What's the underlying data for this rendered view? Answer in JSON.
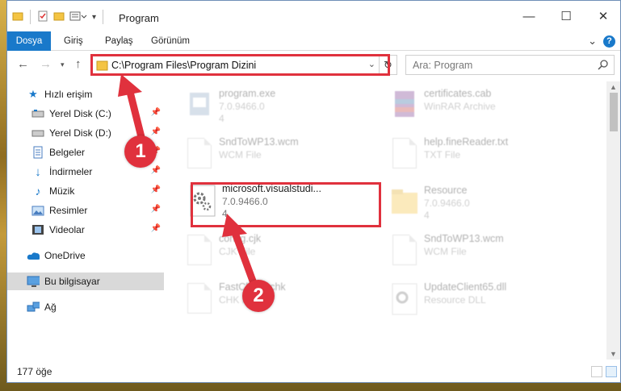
{
  "window": {
    "title": "Program",
    "minimize_glyph": "—",
    "maximize_glyph": "☐",
    "close_glyph": "✕"
  },
  "ribbon": {
    "tabs": [
      "Dosya",
      "Giriş",
      "Paylaş",
      "Görünüm"
    ],
    "expand_glyph": "⌄",
    "help_glyph": "?"
  },
  "address": {
    "path": "C:\\Program Files\\Program Dizini",
    "search_placeholder": "Ara: Program"
  },
  "nav": {
    "quick_access": "Hızlı erişim",
    "items": [
      {
        "label": "Yerel Disk (C:)",
        "icon": "drive-icon",
        "pinned": true
      },
      {
        "label": "Yerel Disk (D:)",
        "icon": "drive-icon",
        "pinned": true
      },
      {
        "label": "Belgeler",
        "icon": "documents-icon",
        "pinned": true
      },
      {
        "label": "İndirmeler",
        "icon": "downloads-icon",
        "pinned": true
      },
      {
        "label": "Müzik",
        "icon": "music-icon",
        "pinned": true
      },
      {
        "label": "Resimler",
        "icon": "pictures-icon",
        "pinned": true
      },
      {
        "label": "Videolar",
        "icon": "videos-icon",
        "pinned": true
      }
    ],
    "onedrive": "OneDrive",
    "this_pc": "Bu bilgisayar",
    "network": "Ağ"
  },
  "files": [
    {
      "name": "program.exe",
      "type": "7.0.9466.0",
      "size": "4",
      "icon": "exe-icon",
      "faded": true
    },
    {
      "name": "certificates.cab",
      "type": "WinRAR Archive",
      "size": "",
      "icon": "archive-icon",
      "faded": true
    },
    {
      "name": "SndToWP13.wcm",
      "type": "WCM File",
      "size": "",
      "icon": "file-icon",
      "faded": true
    },
    {
      "name": "help.fineReader.txt",
      "type": "TXT File",
      "size": "",
      "icon": "file-icon",
      "faded": true
    },
    {
      "name": "microsoft.visualstudi...",
      "type": "7.0.9466.0",
      "size": "4",
      "icon": "dll-gear-icon",
      "faded": false
    },
    {
      "name": "Resource",
      "type": "7.0.9466.0",
      "size": "4",
      "icon": "folder-icon",
      "faded": true
    },
    {
      "name": "config.cjk",
      "type": "CJK File",
      "size": "",
      "icon": "file-icon",
      "faded": true
    },
    {
      "name": "SndToWP13.wcm",
      "type": "WCM File",
      "size": "",
      "icon": "file-icon",
      "faded": true
    },
    {
      "name": "FastCheck.chk",
      "type": "CHK File",
      "size": "",
      "icon": "file-icon",
      "faded": true
    },
    {
      "name": "UpdateClient65.dll",
      "type": "Resource DLL",
      "size": "",
      "icon": "dll-gear-icon",
      "faded": true
    }
  ],
  "status": {
    "count": "177 öğe"
  },
  "annotations": {
    "step1": "1",
    "step2": "2",
    "color": "#e0313d"
  },
  "colors": {
    "accent": "#1979ca",
    "selection": "#d9d9d9"
  }
}
